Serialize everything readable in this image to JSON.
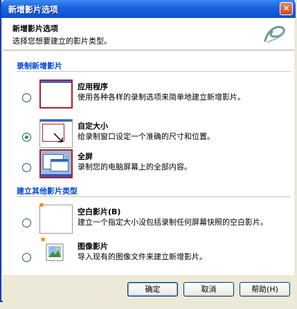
{
  "window": {
    "title": "新增影片选项",
    "close_glyph": "✕"
  },
  "header": {
    "title": "新增影片选项",
    "subtitle": "选择您想要建立的影片类型。"
  },
  "sections": [
    {
      "title": "录制新增影片",
      "options": [
        {
          "title": "应用程序",
          "desc": "使用各种各样的录制选项来简单地建立新增影片。",
          "checked": false
        },
        {
          "title": "自定大小",
          "desc": "给录制窗口设定一个准确的尺寸和位置。",
          "checked": true
        },
        {
          "title": "全屏",
          "desc": "录制您的电脑屏幕上的全部内容。",
          "checked": false
        }
      ]
    },
    {
      "title": "建立其他影片类型",
      "options": [
        {
          "title": "空白影片(B)",
          "desc": "建立一个指定大小没包括录制任何屏幕快照的空白影片。",
          "checked": false
        },
        {
          "title": "图像影片",
          "desc": "导入现有的图像文件来建立新增影片。",
          "checked": false
        }
      ]
    }
  ],
  "buttons": {
    "ok": "确定",
    "cancel": "取消",
    "help": "帮助(H)"
  },
  "colors": {
    "title_bar": "#0b4fd2",
    "section_title": "#0046d5",
    "accent_red": "#b0202a"
  }
}
